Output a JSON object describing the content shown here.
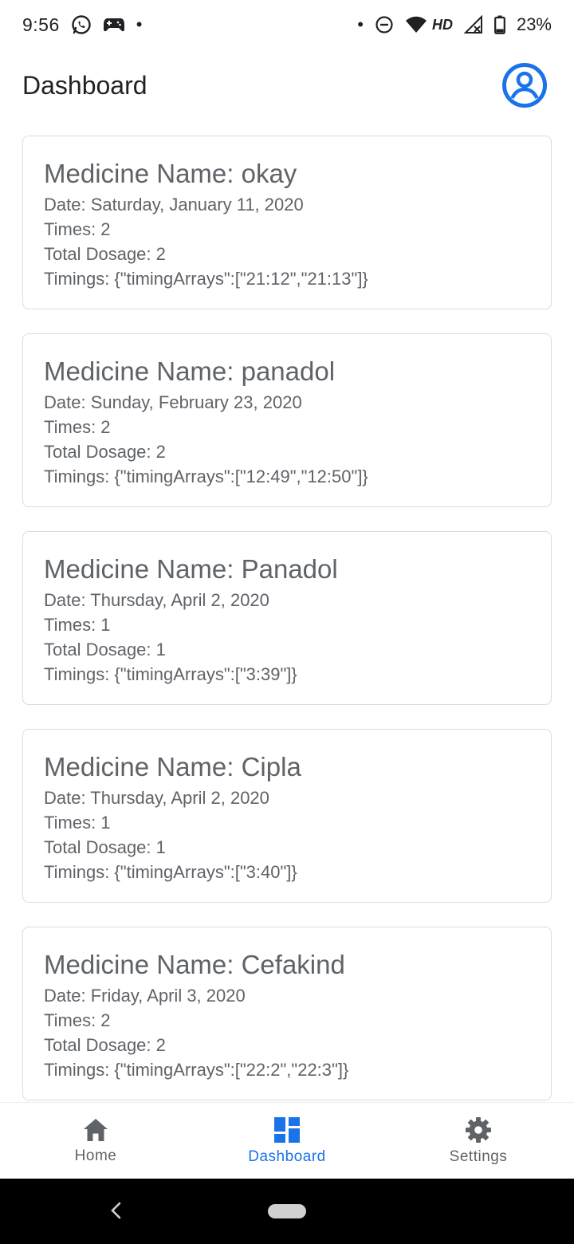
{
  "status_bar": {
    "time": "9:56",
    "left_icons": [
      "whatsapp-icon",
      "game-controller-icon",
      "dot"
    ],
    "right_icons": [
      "dot",
      "do-not-disturb-icon",
      "wifi-icon",
      "signal-icon",
      "battery-icon"
    ],
    "network_label": "HD",
    "battery": "23%"
  },
  "app_bar": {
    "title": "Dashboard",
    "profile_icon": "account-circle-icon",
    "accent": "#1a73e8"
  },
  "medicines": [
    {
      "title": "Medicine Name: okay",
      "date": "Date: Saturday, January 11, 2020",
      "times": "Times: 2",
      "dosage": "Total Dosage: 2",
      "timings": "Timings: {\"timingArrays\":[\"21:12\",\"21:13\"]}"
    },
    {
      "title": "Medicine Name: panadol",
      "date": "Date: Sunday, February 23, 2020",
      "times": "Times: 2",
      "dosage": "Total Dosage: 2",
      "timings": "Timings: {\"timingArrays\":[\"12:49\",\"12:50\"]}"
    },
    {
      "title": "Medicine Name: Panadol",
      "date": "Date: Thursday, April 2, 2020",
      "times": "Times: 1",
      "dosage": "Total Dosage: 1",
      "timings": "Timings: {\"timingArrays\":[\"3:39\"]}"
    },
    {
      "title": "Medicine Name: Cipla",
      "date": "Date: Thursday, April 2, 2020",
      "times": "Times: 1",
      "dosage": "Total Dosage: 1",
      "timings": "Timings: {\"timingArrays\":[\"3:40\"]}"
    },
    {
      "title": "Medicine Name: Cefakind",
      "date": "Date: Friday, April 3, 2020",
      "times": "Times: 2",
      "dosage": "Total Dosage: 2",
      "timings": "Timings: {\"timingArrays\":[\"22:2\",\"22:3\"]}"
    }
  ],
  "bottom_nav": {
    "items": [
      {
        "label": "Home",
        "icon": "home-icon",
        "active": false
      },
      {
        "label": "Dashboard",
        "icon": "dashboard-icon",
        "active": true
      },
      {
        "label": "Settings",
        "icon": "settings-icon",
        "active": false
      }
    ]
  },
  "colors": {
    "accent": "#1a73e8",
    "text_primary": "#202124",
    "text_secondary": "#5f6368",
    "card_border": "#dadce0"
  }
}
